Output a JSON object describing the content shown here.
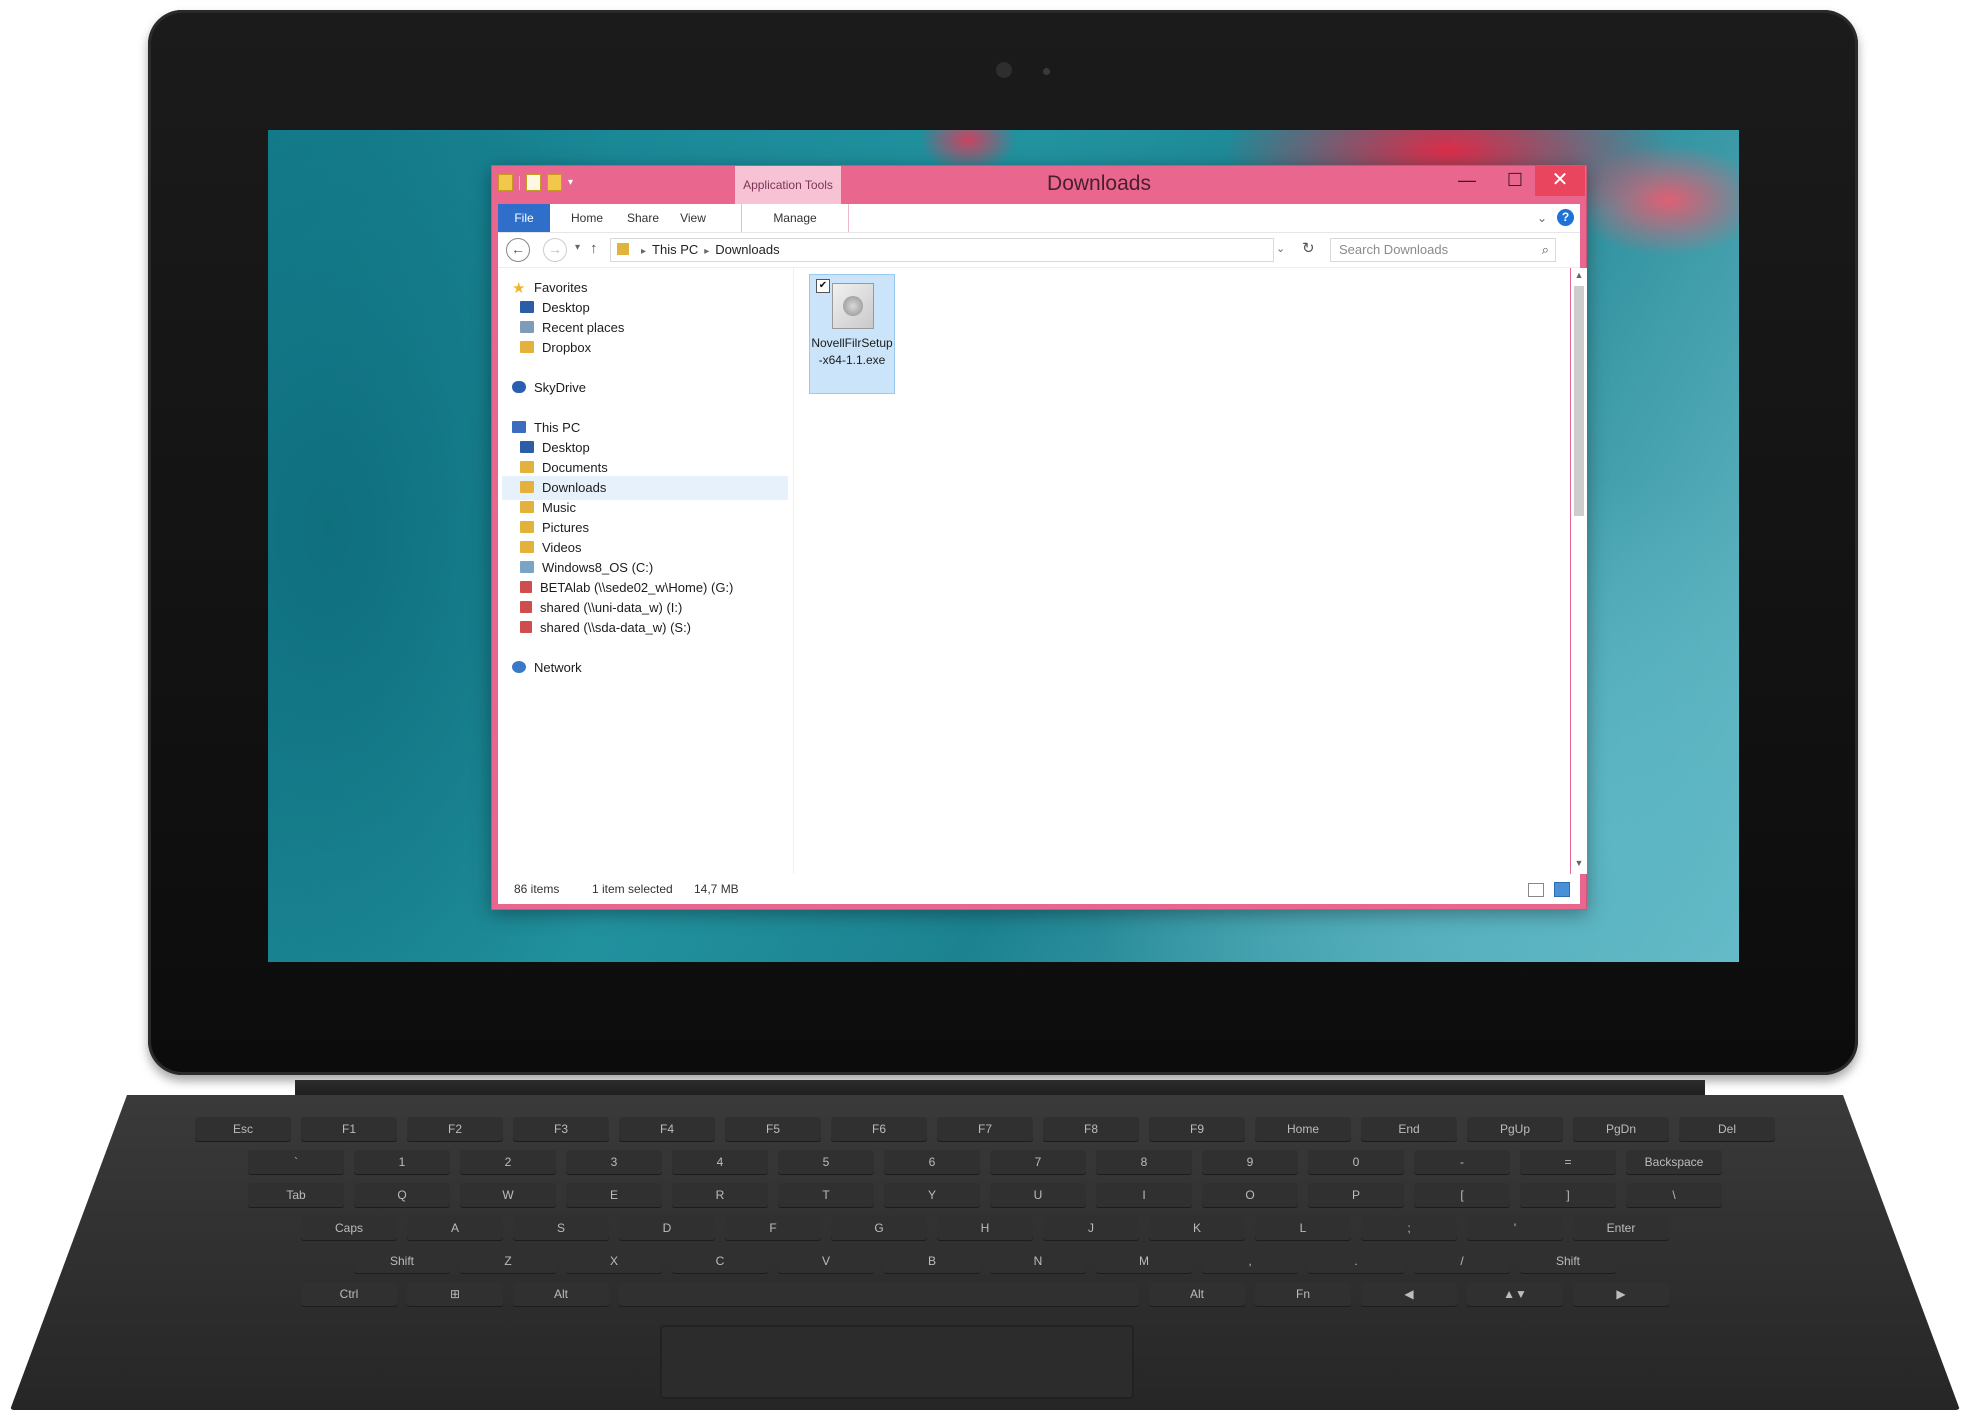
{
  "window": {
    "title": "Downloads",
    "app_tools_label": "Application Tools",
    "buttons": {
      "minimize": "—",
      "maximize": "☐",
      "close": "✕"
    }
  },
  "ribbon": {
    "tabs": {
      "file": "File",
      "home": "Home",
      "share": "Share",
      "view": "View",
      "manage": "Manage"
    },
    "expand": "⌄",
    "help": "?"
  },
  "address": {
    "back": "←",
    "forward": "→",
    "recent": "▾",
    "up": "↑",
    "separator": "▸",
    "crumbs": [
      "This PC",
      "Downloads"
    ],
    "dropdown": "⌄",
    "refresh": "↻",
    "search_placeholder": "Search Downloads",
    "search_icon": "⌕"
  },
  "nav": {
    "favorites": "Favorites",
    "fav_items": [
      "Desktop",
      "Recent places",
      "Dropbox"
    ],
    "skydrive": "SkyDrive",
    "this_pc": "This PC",
    "pc_items": [
      "Desktop",
      "Documents",
      "Downloads",
      "Music",
      "Pictures",
      "Videos",
      "Windows8_OS (C:)",
      "BETAlab (\\\\sede02_w\\Home) (G:)",
      "shared (\\\\uni-data_w) (I:)",
      "shared (\\\\sda-data_w) (S:)"
    ],
    "network": "Network",
    "selected": "Downloads"
  },
  "files": [
    {
      "name": "NovellFilrSetup-x64-1.1.exe",
      "checked": true,
      "check_mark": "✔"
    }
  ],
  "scrollbar": {
    "up": "▲",
    "down": "▼"
  },
  "status": {
    "item_count": "86 items",
    "selection": "1 item selected",
    "size": "14,7 MB"
  },
  "colors": {
    "window_accent": "#e9678e",
    "file_tab": "#2f6fc9",
    "selection": "#cbe4fa"
  },
  "keyboard": {
    "row1": [
      "Esc",
      "F1",
      "F2",
      "F3",
      "F4",
      "F5",
      "F6",
      "F7",
      "F8",
      "F9",
      "Home",
      "End",
      "PgUp",
      "PgDn",
      "Del"
    ],
    "row2": [
      "`",
      "1",
      "2",
      "3",
      "4",
      "5",
      "6",
      "7",
      "8",
      "9",
      "0",
      "-",
      "=",
      "Backspace"
    ],
    "row3": [
      "Tab",
      "Q",
      "W",
      "E",
      "R",
      "T",
      "Y",
      "U",
      "I",
      "O",
      "P",
      "[",
      "]",
      "\\"
    ],
    "row4": [
      "Caps",
      "A",
      "S",
      "D",
      "F",
      "G",
      "H",
      "J",
      "K",
      "L",
      ";",
      "'",
      "Enter"
    ],
    "row5": [
      "Shift",
      "Z",
      "X",
      "C",
      "V",
      "B",
      "N",
      "M",
      ",",
      ".",
      "/",
      "Shift"
    ],
    "row6": [
      "Ctrl",
      "⊞",
      "Alt",
      "",
      "Alt",
      "Fn",
      "◀",
      "▲▼",
      "▶"
    ]
  }
}
